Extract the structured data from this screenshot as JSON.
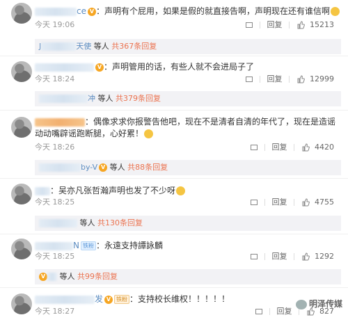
{
  "colors": {
    "accent": "#eb7350",
    "link": "#eb7350",
    "reply_bg": "#f2f2f5"
  },
  "comments": [
    {
      "name_tail": "ce",
      "text": "声明有个屁用，如果是假的就直接告啊，声明现在还有谁信啊",
      "time": "今天 19:06",
      "reply": "回复",
      "likes": "15213",
      "thread": {
        "name_tail": "J",
        "name_tail2": "天使",
        "suffix": "等人",
        "count": "共367条回复"
      }
    },
    {
      "name_tail": "",
      "text": "声明管用的话，有些人就不会进局子了",
      "time": "今天 18:24",
      "reply": "回复",
      "likes": "12999",
      "thread": {
        "name_tail": "冲",
        "suffix": "等人",
        "count": "共379条回复"
      }
    },
    {
      "name_tail": "",
      "text": "偶像求求你报警告他吧，现在不是清者自清的年代了，现在是造谣动动嘴辟谣跑断腿，心好累！",
      "time": "今天 18:26",
      "reply": "回复",
      "likes": "4420",
      "thread": {
        "name_tail": "by-V",
        "suffix": "等人",
        "count": "共88条回复"
      }
    },
    {
      "name_tail": "",
      "text": "吴亦凡张哲瀚声明也发了不少呀",
      "time": "今天 18:25",
      "reply": "回复",
      "likes": "4755",
      "thread": {
        "name_tail": "",
        "suffix": "等人",
        "count": "共130条回复"
      }
    },
    {
      "name_tail": "N",
      "badge": "铁粉",
      "text": "永遠支持譚詠麟",
      "time": "今天 18:25",
      "reply": "回复",
      "likes": "1292",
      "thread": {
        "name_tail": "",
        "suffix": "等人",
        "count": "共99条回复"
      }
    },
    {
      "name_tail": "发",
      "badge": "铁粉",
      "text": "支持校长维权！！！！！",
      "time": "今天 18:27",
      "reply": "回复",
      "likes": "827"
    }
  ],
  "watermark": "明泽传媒",
  "icons": {
    "forward": "forward-icon",
    "like": "thumb-up-icon",
    "vip": "vip-badge-icon"
  }
}
